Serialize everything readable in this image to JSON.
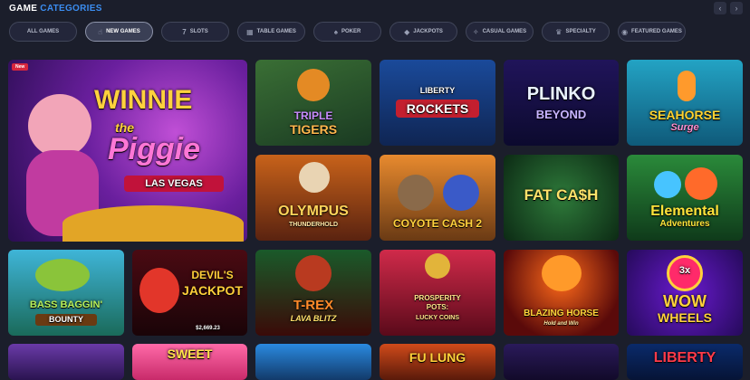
{
  "header": {
    "title_part1": "GAME",
    "title_part2": "CATEGORIES"
  },
  "nav": {
    "prev": "‹",
    "next": "›"
  },
  "tabs": [
    {
      "label": "ALL GAMES",
      "icon": ""
    },
    {
      "label": "NEW GAMES",
      "icon": "☝"
    },
    {
      "label": "SLOTS",
      "icon": "7"
    },
    {
      "label": "TABLE GAMES",
      "icon": "▦"
    },
    {
      "label": "POKER",
      "icon": "♠"
    },
    {
      "label": "JACKPOTS",
      "icon": "◆"
    },
    {
      "label": "CASUAL GAMES",
      "icon": "✧"
    },
    {
      "label": "SPECIALTY",
      "icon": "♛"
    },
    {
      "label": "FEATURED GAMES",
      "icon": "◉"
    }
  ],
  "games": {
    "winnie": {
      "badge": "New",
      "line1": "WINNIE",
      "line2": "the",
      "line3": "Piggie",
      "line4": "LAS VEGAS"
    },
    "triple_tigers": {
      "line1": "TRIPLE",
      "line2": "TIGERS"
    },
    "liberty_rockets": {
      "line1": "LIBERTY",
      "line2": "ROCKETS"
    },
    "plinko": {
      "line1": "PLINKO",
      "line2": "BEYOND"
    },
    "seahorse": {
      "line1": "SEAHORSE",
      "line2": "Surge"
    },
    "olympus": {
      "line1": "OLYMPUS",
      "line2": "THUNDERHOLD"
    },
    "coyote": {
      "line1": "COYOTE CASH 2"
    },
    "fat_cash": {
      "line1": "FAT CA$H"
    },
    "elemental": {
      "line1": "Elemental",
      "line2": "Adventures"
    },
    "bass": {
      "line1": "BASS BAGGIN'",
      "line2": "BOUNTY"
    },
    "devils": {
      "line1": "DEVIL'S",
      "line2": "JACKPOT",
      "line3": "$2,669.23"
    },
    "trex": {
      "line1": "T-REX",
      "line2": "LAVA BLITZ"
    },
    "prosperity": {
      "line1": "PROSPERITY",
      "line2": "POTS:",
      "line3": "LUCKY COINS"
    },
    "blazing": {
      "line1": "BLAZING HORSE",
      "line2": "Hold and Win"
    },
    "wow": {
      "line1": "3x",
      "line2": "WOW",
      "line3": "WHEELS"
    },
    "bottom5": {
      "line1": "LIBERTY"
    },
    "bottom2": {
      "line1": "SWEET"
    },
    "bottom4": {
      "line1": "FU LUNG"
    }
  }
}
